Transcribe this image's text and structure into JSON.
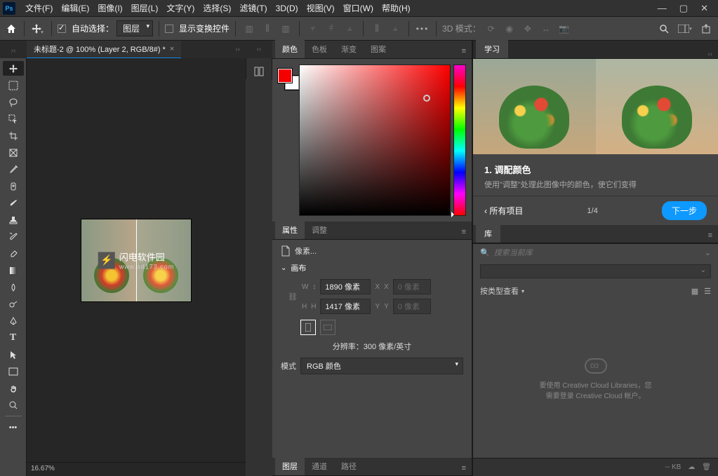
{
  "menu": [
    "文件(F)",
    "编辑(E)",
    "图像(I)",
    "图层(L)",
    "文字(Y)",
    "选择(S)",
    "滤镜(T)",
    "3D(D)",
    "视图(V)",
    "窗口(W)",
    "帮助(H)"
  ],
  "optbar": {
    "auto_select_label": "自动选择：",
    "auto_select_target": "图层",
    "show_transform": "显示变换控件",
    "mode3d": "3D 模式："
  },
  "doc": {
    "tab_title": "未标题-2 @ 100% (Layer 2, RGB/8#) *",
    "zoom_status": "16.67%"
  },
  "panels": {
    "color_tabs": [
      "颜色",
      "色板",
      "渐变",
      "图案"
    ],
    "prop_tabs": [
      "属性",
      "调整"
    ],
    "layer_tabs": [
      "图层",
      "通道",
      "路径"
    ]
  },
  "properties": {
    "type_label": "像素...",
    "canvas_label": "画布",
    "w_lbl": "W",
    "h_lbl": "H",
    "x_lbl": "X",
    "y_lbl": "Y",
    "w_val": "1890 像素",
    "h_val": "1417 像素",
    "x_ph": "0 像素",
    "y_ph": "0 像素",
    "res_label": "分辨率：300 像素/英寸",
    "mode_label": "模式",
    "mode_val": "RGB 颜色"
  },
  "learn": {
    "tab": "学习",
    "title": "1.  调配颜色",
    "desc": "使用\"调整\"处理此图像中的颜色，使它们变得",
    "back": "‹ 所有项目",
    "page": "1/4",
    "next": "下一步"
  },
  "library": {
    "tab": "库",
    "search_ph": "搜索当前库",
    "filter_label": "按类型查看",
    "empty_l1": "要使用 Creative Cloud Libraries，您",
    "empty_l2": "需要登录 Creative Cloud 帐户。",
    "size": "-- KB"
  },
  "watermark": {
    "name": "闪电软件园",
    "url": "www.sd173.com"
  }
}
